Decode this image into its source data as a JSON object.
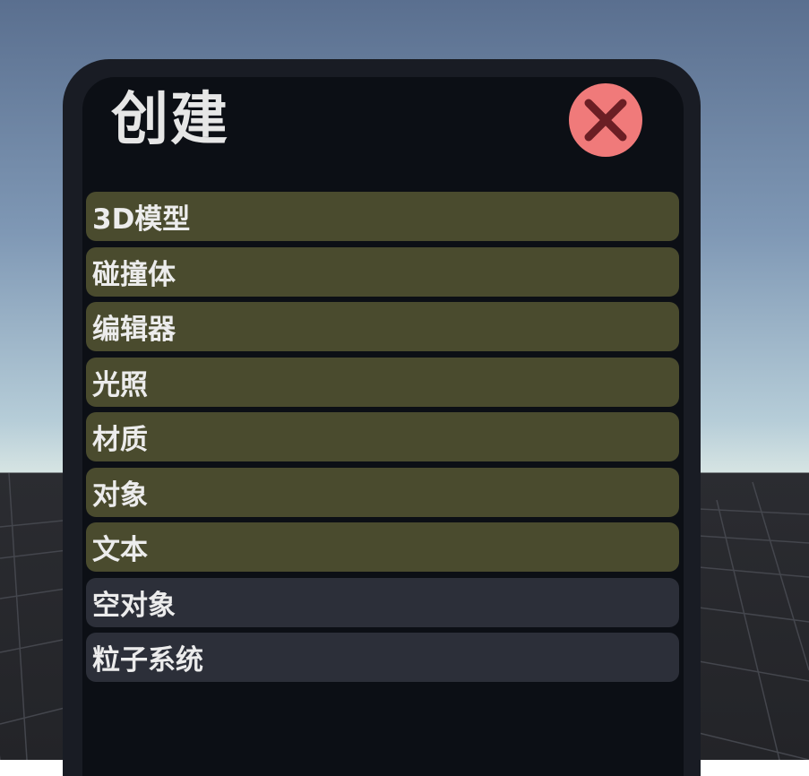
{
  "panel": {
    "title": "创建",
    "close_icon": "close-x-icon"
  },
  "colors": {
    "olive_item": "#4a4b2e",
    "slate_item": "#2c2f39",
    "close_button": "#f07a7a",
    "close_x": "#6b1e24"
  },
  "menu": {
    "items": [
      {
        "label": "3D模型",
        "style": "olive"
      },
      {
        "label": "碰撞体",
        "style": "olive"
      },
      {
        "label": "编辑器",
        "style": "olive"
      },
      {
        "label": "光照",
        "style": "olive"
      },
      {
        "label": "材质",
        "style": "olive"
      },
      {
        "label": "对象",
        "style": "olive"
      },
      {
        "label": "文本",
        "style": "olive"
      },
      {
        "label": "空对象",
        "style": "slate"
      },
      {
        "label": "粒子系统",
        "style": "slate"
      }
    ]
  }
}
